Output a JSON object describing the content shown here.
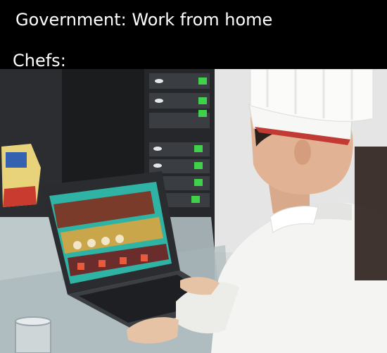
{
  "meme": {
    "caption_top": "Government: Work from home",
    "caption_bottom": "Chefs:"
  },
  "photo": {
    "subject": "chef in white hat and jacket at a laptop showing a cooking game",
    "colors": {
      "background": "#000000",
      "caption_text": "#ffffff",
      "wall": "#d9dbdc",
      "rack": "#1b1c1e",
      "led_green": "#3fd14a",
      "chef_white": "#f4f4f2",
      "laptop": "#2a2c30",
      "game_green": "#2fb3a4"
    }
  }
}
